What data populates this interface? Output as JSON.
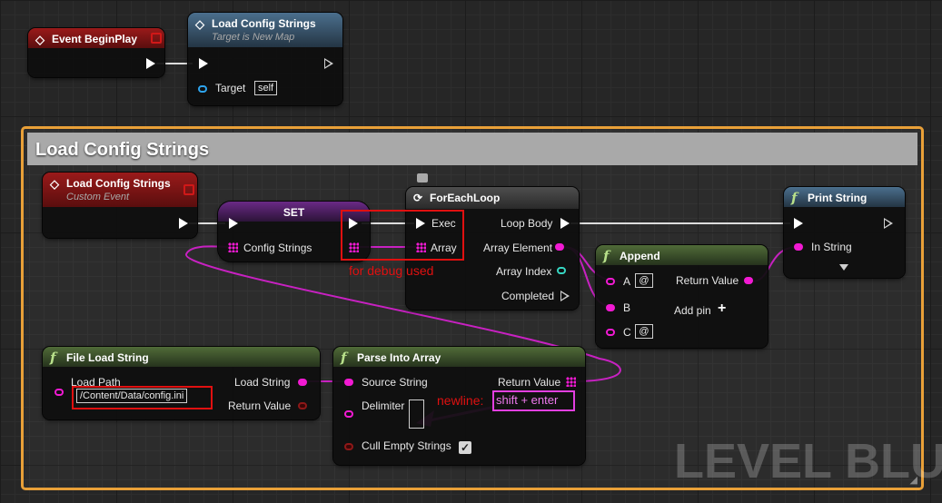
{
  "top_nodes": {
    "event_begin_play": {
      "title": "Event BeginPlay"
    },
    "load_config_call": {
      "title": "Load Config Strings",
      "subtitle": "Target is New Map",
      "target_label": "Target",
      "target_value": "self"
    }
  },
  "comment_box": {
    "title": "Load Config Strings"
  },
  "custom_event": {
    "title": "Load Config Strings",
    "subtitle": "Custom Event"
  },
  "set_node": {
    "title": "SET",
    "var_label": "Config Strings"
  },
  "foreach": {
    "title": "ForEachLoop",
    "exec_in": "Exec",
    "array_in": "Array",
    "loop_body": "Loop Body",
    "array_element": "Array Element",
    "array_index": "Array Index",
    "completed": "Completed"
  },
  "print_string": {
    "title": "Print String",
    "in_string": "In String"
  },
  "append": {
    "title": "Append",
    "a": "A",
    "a_value": "@",
    "b": "B",
    "c": "C",
    "c_value": "@",
    "return_value": "Return Value",
    "add_pin": "Add pin"
  },
  "file_load": {
    "title": "File Load String",
    "load_path": "Load Path",
    "load_path_value": "/Content/Data/config.ini",
    "load_string": "Load String",
    "return_value": "Return Value"
  },
  "parse": {
    "title": "Parse Into Array",
    "source_string": "Source String",
    "return_value": "Return Value",
    "delimiter": "Delimiter",
    "cull_empty": "Cull Empty Strings"
  },
  "annotations": {
    "debug": "for debug used",
    "newline": "newline:",
    "shortcut": "shift + enter"
  },
  "watermark": "LEVEL BLUE"
}
